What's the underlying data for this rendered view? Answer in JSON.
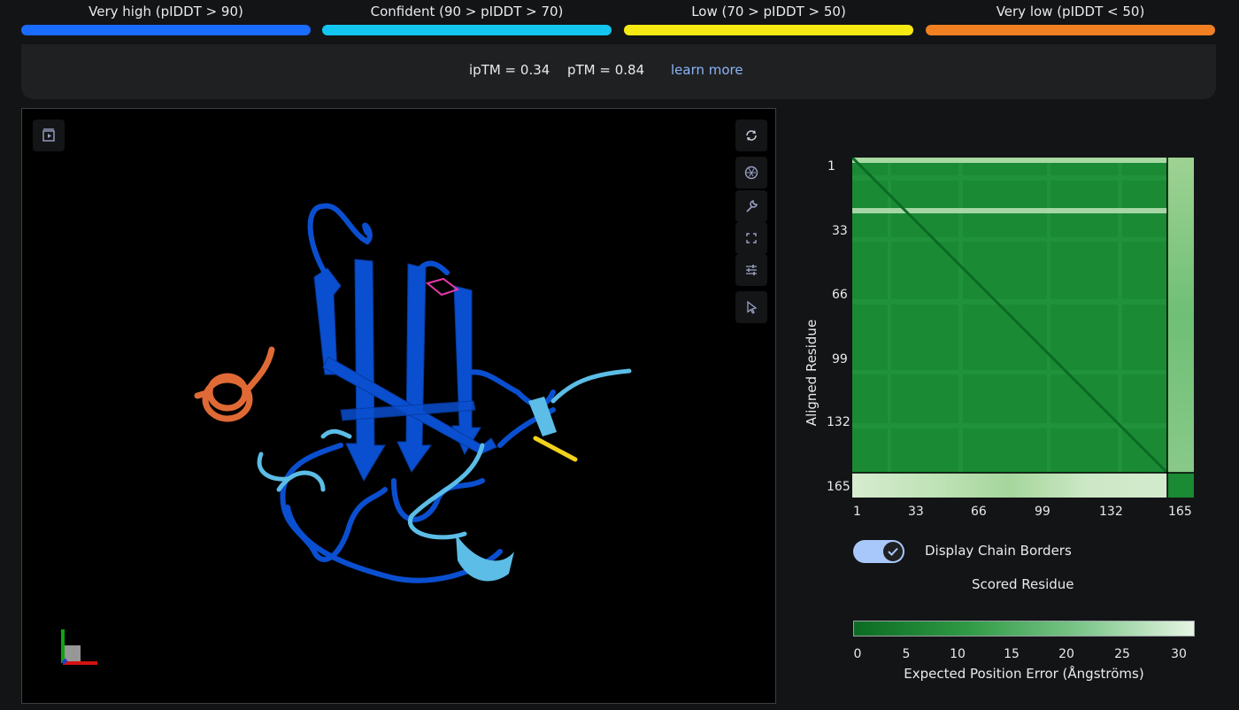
{
  "legend": [
    {
      "label": "Very high (pIDDT > 90)",
      "color": "#1a6bff"
    },
    {
      "label": "Confident (90 > pIDDT > 70)",
      "color": "#13c6ef"
    },
    {
      "label": "Low (70 > pIDDT > 50)",
      "color": "#f7ea12"
    },
    {
      "label": "Very low (pIDDT < 50)",
      "color": "#f08022"
    }
  ],
  "metrics": {
    "iptm": "ipTM = 0.34",
    "ptm": "pTM = 0.84",
    "learn_more": "learn more"
  },
  "viewer": {
    "tools": [
      "play-panel-icon",
      "rotate-icon",
      "camera-aperture-icon",
      "wrench-icon",
      "fullscreen-icon",
      "sliders-icon",
      "cursor-icon"
    ],
    "colors": {
      "very_high": "#0a4fd0",
      "confident": "#5cbde6",
      "low": "#f2d11e",
      "very_low": "#e06a35",
      "ligand": "#e33ba8"
    }
  },
  "pae": {
    "y_title": "Aligned Residue",
    "x_title": "Scored Residue",
    "y_ticks": [
      "1",
      "33",
      "66",
      "99",
      "132",
      "165"
    ],
    "x_ticks": [
      "1",
      "33",
      "66",
      "99",
      "132",
      "165"
    ],
    "chain_borders_label": "Display Chain Borders",
    "chain_borders_on": true,
    "colorbar_ticks": [
      "0",
      "5",
      "10",
      "15",
      "20",
      "25",
      "30"
    ],
    "colorbar_title": "Expected Position Error (Ångströms)",
    "colorbar_colors": [
      "#0b6b22",
      "#2f9a45",
      "#7cc68a",
      "#e6f5e3"
    ]
  }
}
